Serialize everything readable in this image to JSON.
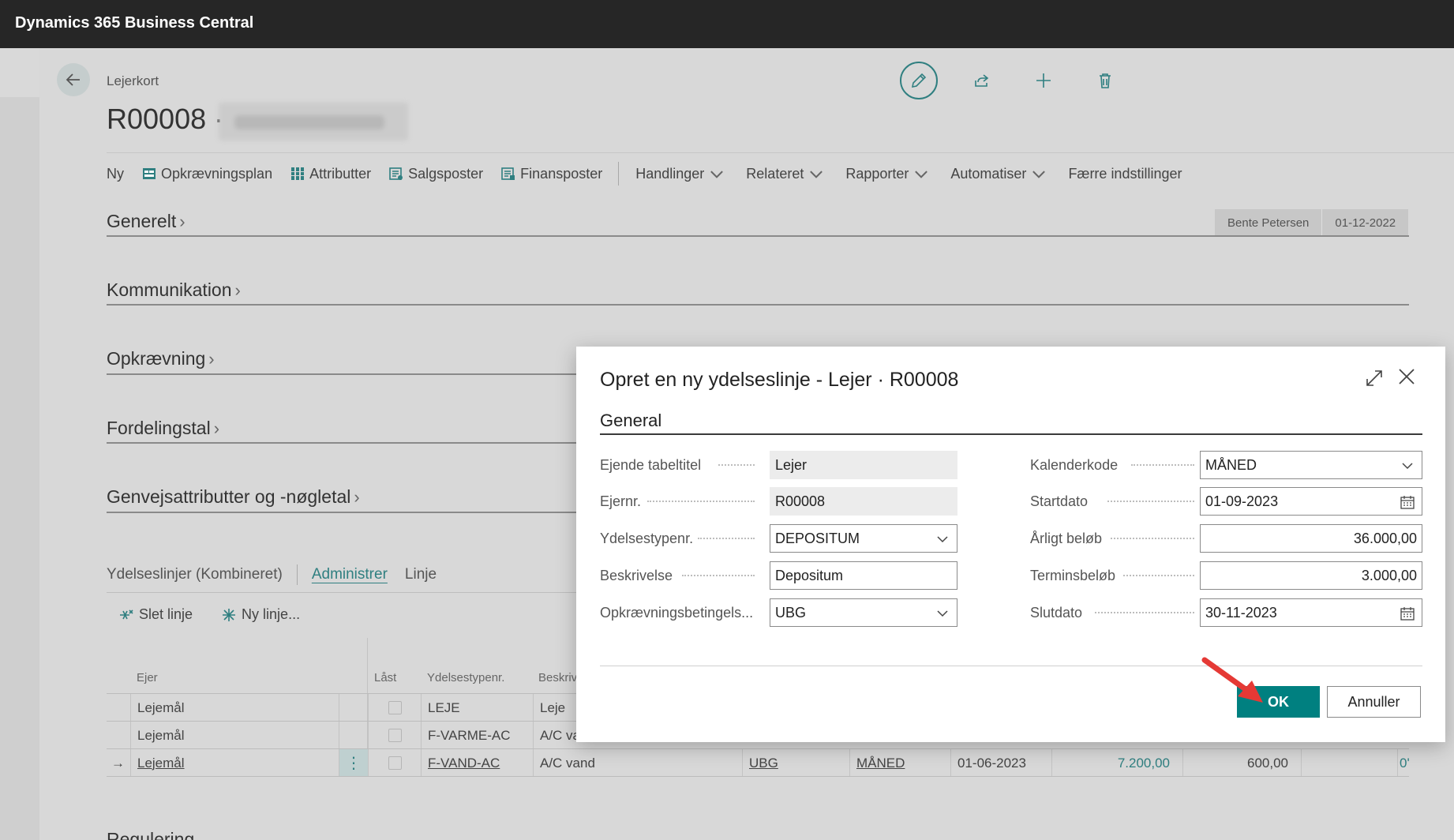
{
  "app": {
    "title": "Dynamics 365 Business Central"
  },
  "page": {
    "breadcrumb": "Lejerkort",
    "record_no": "R00008 ·",
    "header_icons": [
      "pencil-icon",
      "share-icon",
      "plus-icon",
      "trash-icon"
    ]
  },
  "action_bar": {
    "items": [
      {
        "label": "Ny"
      },
      {
        "label": "Opkrævningsplan",
        "icon": "plan-icon"
      },
      {
        "label": "Attributter",
        "icon": "grid-icon"
      },
      {
        "label": "Salgsposter",
        "icon": "ledger-icon"
      },
      {
        "label": "Finansposter",
        "icon": "ledger-icon"
      }
    ],
    "menus": [
      {
        "label": "Handlinger"
      },
      {
        "label": "Relateret"
      },
      {
        "label": "Rapporter"
      },
      {
        "label": "Automatiser"
      }
    ],
    "fewer_options": "Færre indstillinger"
  },
  "badges": {
    "user": "Bente Petersen",
    "date": "01-12-2022"
  },
  "fasttabs": [
    "Generelt",
    "Kommunikation",
    "Opkrævning",
    "Fordelingstal",
    "Genvejsattributter og -nøgletal"
  ],
  "lines": {
    "title": "Ydelseslinjer (Kombineret)",
    "tab_manage": "Administrer",
    "tab_line": "Linje",
    "delete_line": "Slet linje",
    "new_line": "Ny linje...",
    "columns": {
      "owner": "Ejer",
      "locked": "Låst",
      "type": "Ydelsestypenr.",
      "desc": "Beskriv"
    },
    "rows": [
      {
        "owner": "Lejemål",
        "type": "LEJE",
        "desc": "Leje"
      },
      {
        "owner": "Lejemål",
        "type": "F-VARME-AC",
        "desc": "A/C va"
      },
      {
        "owner": "Lejemål",
        "type": "F-VAND-AC",
        "desc": "A/C vand",
        "terms": "UBG",
        "calendar": "MÅNED",
        "start": "01-06-2023",
        "yearly": "7.200,00",
        "term_amount": "600,00",
        "end": "0'"
      }
    ],
    "next_section": "Regulering"
  },
  "dialog": {
    "title": "Opret en ny ydelseslinje - Lejer · R00008",
    "section": "General",
    "left_fields": [
      {
        "label": "Ejende tabeltitel",
        "value": "Lejer",
        "readonly": true
      },
      {
        "label": "Ejernr.",
        "value": "R00008",
        "readonly": true
      },
      {
        "label": "Ydelsestypenr.",
        "value": "DEPOSITUM",
        "control": "dropdown"
      },
      {
        "label": "Beskrivelse",
        "value": "Depositum"
      },
      {
        "label": "Opkrævningsbetingels...",
        "value": "UBG",
        "control": "dropdown"
      }
    ],
    "right_fields": [
      {
        "label": "Kalenderkode",
        "value": "MÅNED",
        "control": "dropdown"
      },
      {
        "label": "Startdato",
        "value": "01-09-2023",
        "control": "date"
      },
      {
        "label": "Årligt beløb",
        "value": "36.000,00"
      },
      {
        "label": "Terminsbeløb",
        "value": "3.000,00"
      },
      {
        "label": "Slutdato",
        "value": "30-11-2023",
        "control": "date"
      }
    ],
    "ok": "OK",
    "cancel": "Annuller"
  },
  "colors": {
    "accent": "#008080",
    "topbar": "#262626",
    "annotation_arrow": "#e53935"
  }
}
